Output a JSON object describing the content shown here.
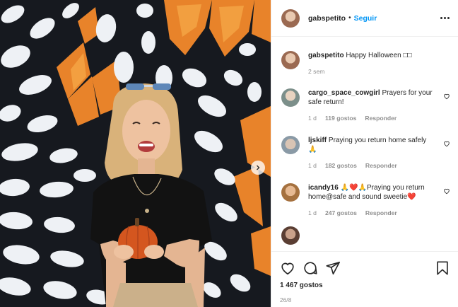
{
  "post": {
    "username": "gabspetito",
    "follow_label": "Seguir",
    "caption_user": "gabspetito",
    "caption_text": "Happy Halloween",
    "caption_emoji": "□□",
    "caption_age": "2 sem",
    "likes": "1 467 gostos",
    "date": "26/8"
  },
  "comments": [
    {
      "user": "cargo_space_cowgirl",
      "text": "Prayers for your safe return!",
      "age": "1 d",
      "likes": "119 gostos",
      "reply": "Responder"
    },
    {
      "user": "ljskiff",
      "text": "Praying you return home safely🙏",
      "age": "1 d",
      "likes": "182 gostos",
      "reply": "Responder"
    },
    {
      "user": "icandy16",
      "text": "🙏❤️🙏Praying you return home@safe and sound sweetie❤️",
      "age": "1 d",
      "likes": "247 gostos",
      "reply": "Responder"
    }
  ],
  "icons": {
    "more": "more-options-icon",
    "like": "heart-icon",
    "comment": "comment-bubble-icon",
    "share": "paper-plane-icon",
    "save": "bookmark-icon",
    "carousel": "chevron-right-icon"
  },
  "colors": {
    "link": "#0095f6",
    "text": "#262626",
    "muted": "#8e8e8e",
    "wall_orange": "#e8832a",
    "wall_dark": "#16191f",
    "pumpkin": "#d4561f"
  }
}
